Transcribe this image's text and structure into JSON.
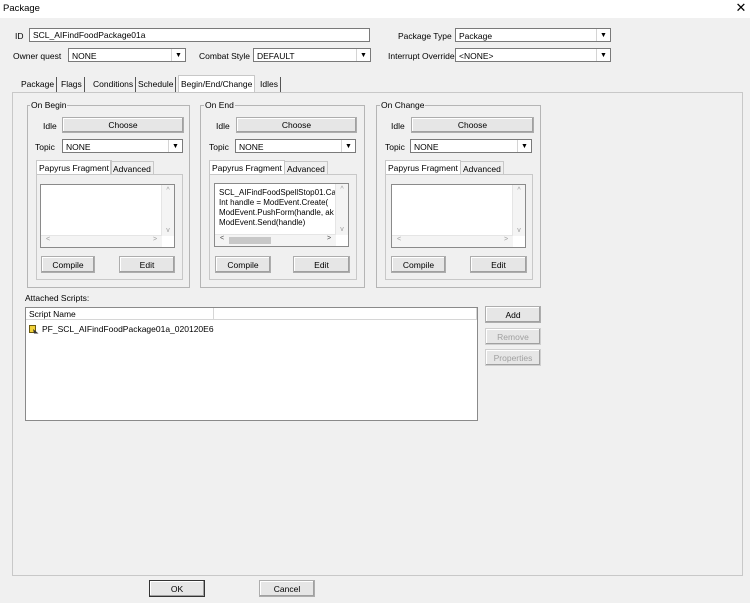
{
  "window": {
    "title": "Package",
    "close_glyph": "✕"
  },
  "form": {
    "id_label": "ID",
    "id_value": "SCL_AIFindFoodPackage01a",
    "package_type_label": "Package Type",
    "package_type_value": "Package",
    "owner_quest_label": "Owner quest",
    "owner_quest_value": "NONE",
    "combat_style_label": "Combat Style",
    "combat_style_value": "DEFAULT",
    "interrupt_override_label": "Interrupt Override",
    "interrupt_override_value": "<NONE>"
  },
  "tabs": [
    "Package",
    "Flags",
    "Conditions",
    "Schedule",
    "Begin/End/Change",
    "Idles"
  ],
  "active_tab": "Begin/End/Change",
  "groups": [
    {
      "title": "On Begin",
      "idle_label": "Idle",
      "choose_label": "Choose",
      "topic_label": "Topic",
      "topic_value": "NONE",
      "subtabs": [
        "Papyrus Fragment",
        "Advanced"
      ],
      "code_lines": [],
      "compile_label": "Compile",
      "edit_label": "Edit"
    },
    {
      "title": "On End",
      "idle_label": "Idle",
      "choose_label": "Choose",
      "topic_label": "Topic",
      "topic_value": "NONE",
      "subtabs": [
        "Papyrus Fragment",
        "Advanced"
      ],
      "code_lines": [
        "SCL_AIFindFoodSpellStop01.Ca",
        "Int handle = ModEvent.Create(",
        "ModEvent.PushForm(handle, ak",
        "ModEvent.Send(handle)"
      ],
      "compile_label": "Compile",
      "edit_label": "Edit"
    },
    {
      "title": "On Change",
      "idle_label": "Idle",
      "choose_label": "Choose",
      "topic_label": "Topic",
      "topic_value": "NONE",
      "subtabs": [
        "Papyrus Fragment",
        "Advanced"
      ],
      "code_lines": [],
      "compile_label": "Compile",
      "edit_label": "Edit"
    }
  ],
  "scripts": {
    "label": "Attached Scripts:",
    "column_header": "Script Name",
    "rows": [
      "PF_SCL_AIFindFoodPackage01a_020120E6"
    ],
    "add_label": "Add",
    "remove_label": "Remove",
    "properties_label": "Properties"
  },
  "footer": {
    "ok_label": "OK",
    "cancel_label": "Cancel"
  },
  "icons": {
    "dropdown": "chevron-down-icon",
    "script": "script-icon",
    "close": "close-icon"
  }
}
